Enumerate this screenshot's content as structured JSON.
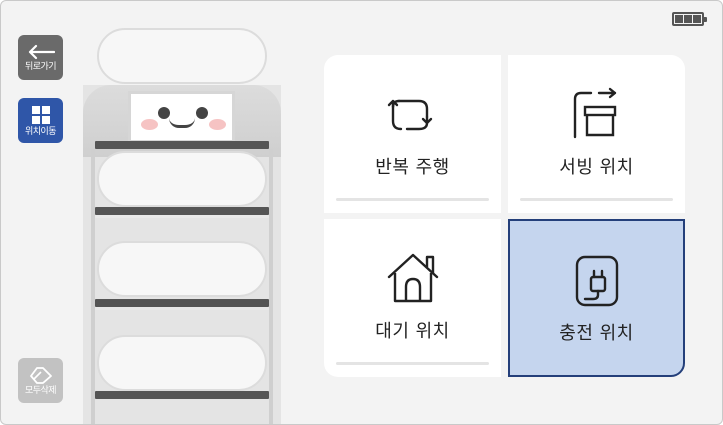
{
  "status": {
    "battery_icon": "battery-full-icon"
  },
  "sidebar": {
    "back": {
      "label": "뒤로가기",
      "icon": "arrow-left-icon"
    },
    "move": {
      "label": "위치이동",
      "icon": "grid-icon",
      "color": "#2f56a8"
    },
    "clear": {
      "label": "모두삭제",
      "icon": "eraser-icon"
    }
  },
  "robot": {
    "face": "robot-face",
    "tray_count": 4
  },
  "actions": {
    "repeat": {
      "label": "반복 주행",
      "icon": "repeat-icon"
    },
    "serving": {
      "label": "서빙 위치",
      "icon": "serving-box-icon"
    },
    "standby": {
      "label": "대기 위치",
      "icon": "home-icon"
    },
    "charging": {
      "label": "충전 위치",
      "icon": "charge-plug-icon",
      "selected": true,
      "highlight_color": "#c5d5ee",
      "border_color": "#243f7a"
    }
  }
}
